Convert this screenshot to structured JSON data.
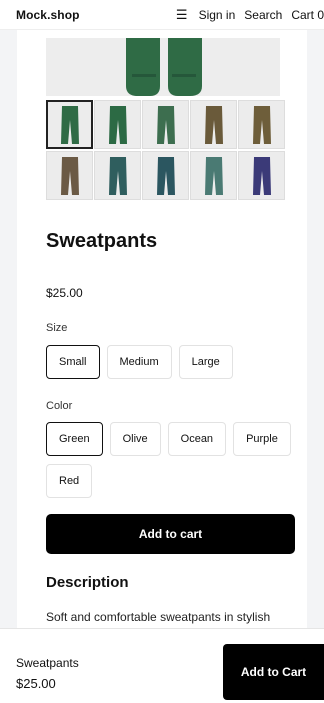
{
  "header": {
    "brand": "Mock.shop",
    "menu_icon": "hamburger-icon",
    "nav": [
      "Sign in",
      "Search",
      "Cart 0"
    ]
  },
  "product": {
    "title": "Sweatpants",
    "price": "$25.00",
    "gallery": {
      "selected_index": 0,
      "thumbnail_colors": [
        "#2f6b45",
        "#2c6a44",
        "#3d6e4f",
        "#6a5a3a",
        "#6e5e3a",
        "#6b5a45",
        "#2f5e5e",
        "#2b5660",
        "#4a7a73",
        "#3b3a78"
      ]
    },
    "size": {
      "label": "Size",
      "options": [
        "Small",
        "Medium",
        "Large"
      ],
      "selected": "Small"
    },
    "color": {
      "label": "Color",
      "options": [
        "Green",
        "Olive",
        "Ocean",
        "Purple",
        "Red"
      ],
      "selected": "Green"
    },
    "add_to_cart": "Add to cart",
    "description_title": "Description",
    "description": "Soft and comfortable sweatpants in stylish shades. The perfect lounge wear for home and on the go."
  },
  "sticky_bar": {
    "name": "Sweatpants",
    "price": "$25.00",
    "button": "Add to Cart"
  },
  "colors": {
    "primary_button": "#000000",
    "page_background": "#f3f4f6"
  }
}
